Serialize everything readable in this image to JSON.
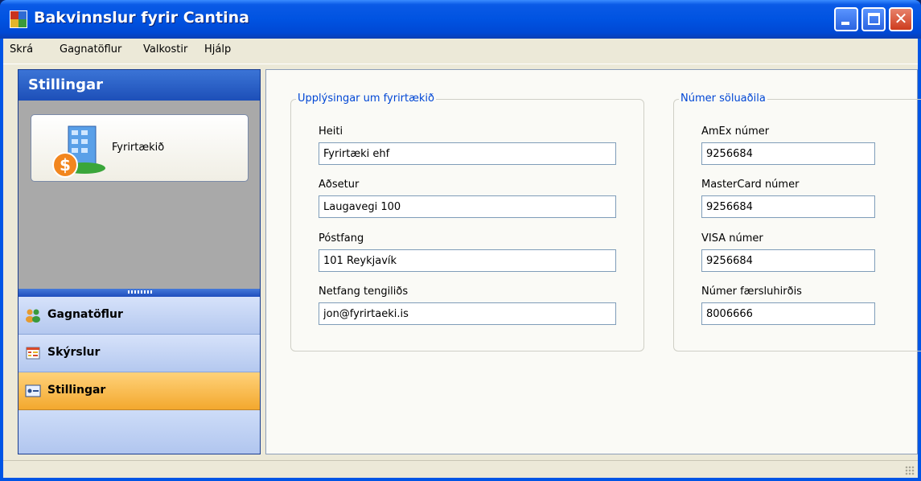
{
  "window": {
    "title": "Bakvinnslur fyrir Cantina",
    "colors": {
      "titlebar": "#0053e1",
      "close": "#cd3b1d"
    }
  },
  "menu": {
    "items": [
      "Skrá",
      "Gagnatöflur",
      "Valkostir",
      "Hjálp"
    ]
  },
  "nav": {
    "header": "Stillingar",
    "tile_label": "Fyrirtækið",
    "buttons": [
      {
        "label": "Gagnatöflur",
        "icon": "people-icon"
      },
      {
        "label": "Skýrslur",
        "icon": "report-icon"
      },
      {
        "label": "Stillingar",
        "icon": "settings-icon",
        "selected": true
      }
    ],
    "selected_color": "#f3a82e"
  },
  "company": {
    "group_title": "Upplýsingar um fyrirtækið",
    "fields": [
      {
        "label": "Heiti",
        "value": "Fyrirtæki ehf"
      },
      {
        "label": "Aðsetur",
        "value": "Laugavegi 100"
      },
      {
        "label": "Póstfang",
        "value": "101 Reykjavík"
      },
      {
        "label": "Netfang tengiliðs",
        "value": "jon@fyrirtaeki.is"
      }
    ]
  },
  "merchant": {
    "group_title": "Númer söluaðila",
    "fields": [
      {
        "label": "AmEx númer",
        "value": "9256684"
      },
      {
        "label": "MasterCard númer",
        "value": "9256684"
      },
      {
        "label": "VISA númer",
        "value": "9256684"
      },
      {
        "label": "Númer færsluhirðis",
        "value": "8006666"
      }
    ]
  }
}
